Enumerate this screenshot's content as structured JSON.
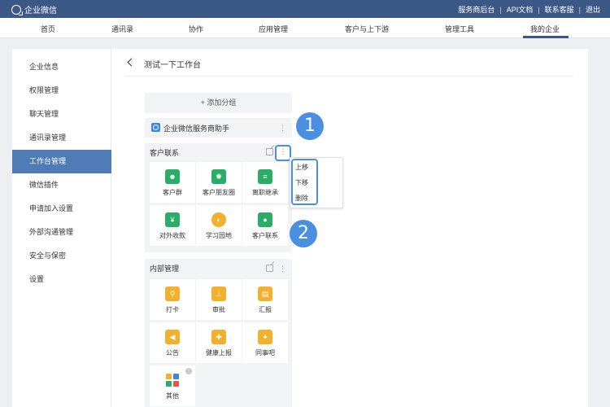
{
  "topbar": {
    "brand": "企业微信",
    "links": [
      "服务商后台",
      "API文档",
      "联系客服",
      "退出"
    ],
    "color": "#3b5887"
  },
  "nav": {
    "items": [
      "首页",
      "通讯录",
      "协作",
      "应用管理",
      "客户与上下游",
      "管理工具",
      "我的企业"
    ],
    "active": "我的企业"
  },
  "sidebar": {
    "items": [
      "企业信息",
      "权限管理",
      "聊天管理",
      "通讯录管理",
      "工作台管理",
      "微信插件",
      "申请加入设置",
      "外部沟通管理",
      "安全与保密",
      "设置"
    ],
    "active": "工作台管理",
    "active_color": "#4f7bb6"
  },
  "page": {
    "title": "测试一下工作台",
    "add_group": "+ 添加分组",
    "helper_label": "企业微信服务商助手"
  },
  "groups": [
    {
      "title": "客户联系",
      "apps": [
        "客户群",
        "客户朋友圈",
        "离职继承",
        "对外收款",
        "学习园地",
        "客户联系"
      ]
    },
    {
      "title": "内部管理",
      "apps": [
        "打卡",
        "审批",
        "汇报",
        "公告",
        "健康上报",
        "同事吧",
        "其他"
      ]
    }
  ],
  "context_menu": {
    "items": [
      "上移",
      "下移",
      "删除"
    ]
  },
  "callouts": [
    "1",
    "2"
  ],
  "accent": "#4a90e2"
}
